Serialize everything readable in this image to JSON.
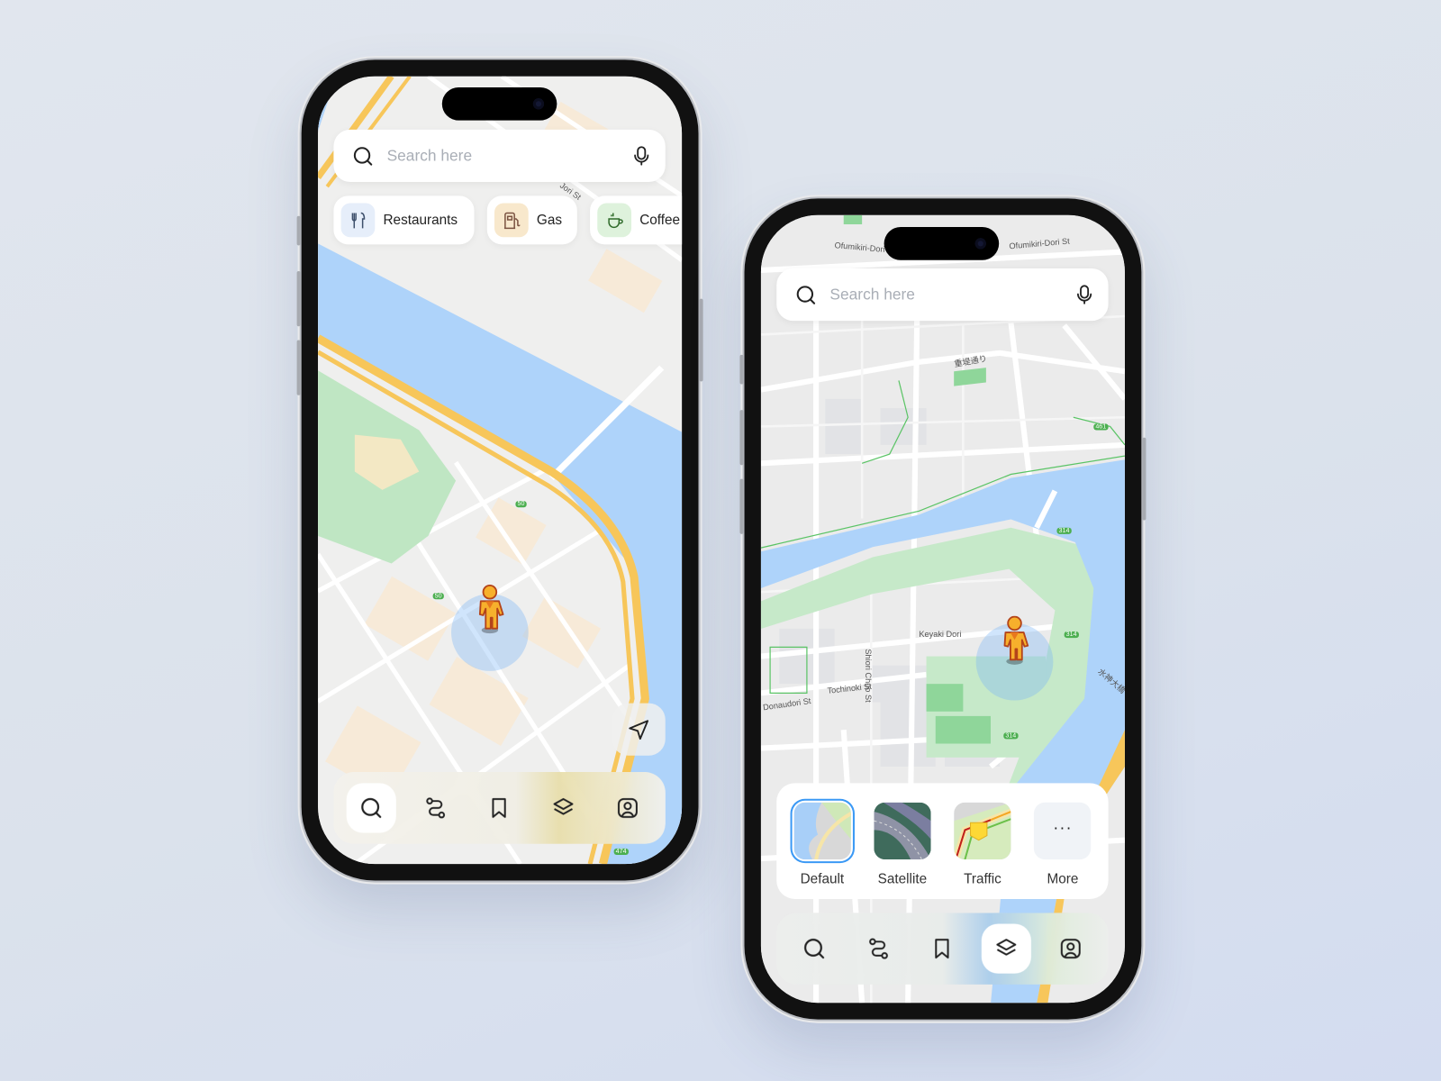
{
  "left_phone": {
    "search": {
      "placeholder": "Search here",
      "left_icon": "search-icon",
      "right_icon": "microphone-icon"
    },
    "chips": [
      {
        "label": "Restaurants",
        "icon": "fork-knife-icon",
        "bg": "#e6eefa"
      },
      {
        "label": "Gas",
        "icon": "fuel-pump-icon",
        "bg": "#f8e8cc"
      },
      {
        "label": "Coffee",
        "icon": "coffee-cup-icon",
        "bg": "#def2dc"
      }
    ],
    "map_labels": {
      "street": "Jori St",
      "shield_a": "50",
      "shield_b": "50",
      "shield_c": "474"
    },
    "locate_icon": "navigation-arrow-icon",
    "nav": {
      "active": "search",
      "items": [
        "search",
        "routes",
        "saved",
        "layers",
        "profile"
      ]
    }
  },
  "right_phone": {
    "search": {
      "placeholder": "Search here",
      "left_icon": "search-icon",
      "right_icon": "microphone-icon"
    },
    "map_labels": {
      "top_left": "Ofumikiri-Dori",
      "top_right": "Ofumikiri-Dori St",
      "jp_street": "重堤通り",
      "keyaki": "Keyaki Dori",
      "shiori": "Shiori Chuo St",
      "tochinoki": "Tochinoki St",
      "donaudori": "Donaudori St",
      "jp_right": "水神大橋",
      "shield_461": "461",
      "shield_314": "314"
    },
    "layers": {
      "selected": "Default",
      "items": [
        {
          "label": "Default"
        },
        {
          "label": "Satellite"
        },
        {
          "label": "Traffic"
        },
        {
          "label": "More",
          "icon": "ellipsis-icon"
        }
      ]
    },
    "nav": {
      "active": "layers",
      "items": [
        "search",
        "routes",
        "saved",
        "layers",
        "profile"
      ]
    }
  },
  "colors": {
    "water": "#aed3fa",
    "park": "#bfe6c3",
    "highway": "#f7c65a",
    "accent": "#3b99f5",
    "pin": "#f5a623"
  }
}
